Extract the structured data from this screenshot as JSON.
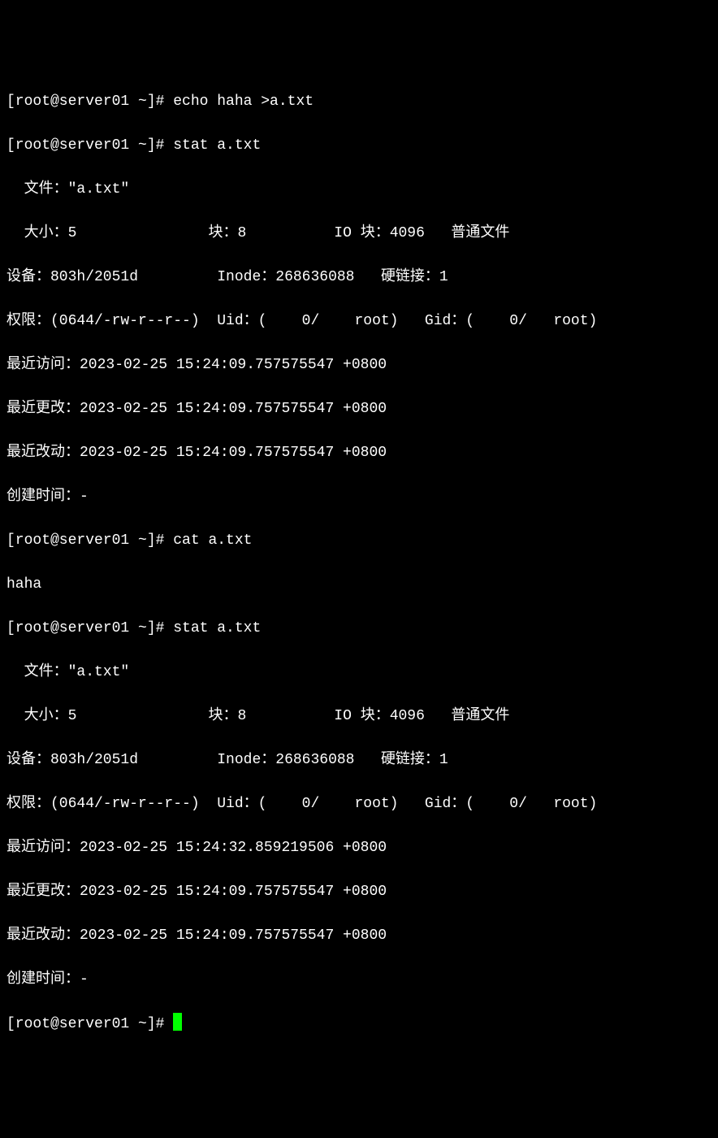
{
  "prompt": "[root@server01 ~]# ",
  "cmd1": "echo haha >a.txt",
  "cmd2": "stat a.txt",
  "file_label": "  文件：",
  "file_value": "\"a.txt\"",
  "size_label": "  大小：",
  "size_value": "5",
  "block_label": "块：",
  "block_value": "8",
  "ioblock_label": "IO 块：",
  "ioblock_value": "4096",
  "filetype": "普通文件",
  "device_label": "设备：",
  "device_value": "803h/2051d",
  "inode_label": "Inode：",
  "inode_value": "268636088",
  "links_label": "硬链接：",
  "links_value": "1",
  "perm_label": "权限：",
  "perm_value": "(0644/-rw-r--r--)",
  "uid_label": "Uid：",
  "uid_value": "(    0/    root)",
  "gid_label": "Gid：",
  "gid_value": "(    0/   root)",
  "atime1_label": "最近访问：",
  "atime1_value": "2023-02-25 15:24:09.757575547 +0800",
  "mtime_label": "最近更改：",
  "mtime_value": "2023-02-25 15:24:09.757575547 +0800",
  "ctime_label": "最近改动：",
  "ctime_value": "2023-02-25 15:24:09.757575547 +0800",
  "btime_label": "创建时间：",
  "btime_value": "-",
  "cmd3": "cat a.txt",
  "cat_output": "haha",
  "cmd4": "stat a.txt",
  "atime2_label": "最近访问：",
  "atime2_value": "2023-02-25 15:24:32.859219506 +0800"
}
